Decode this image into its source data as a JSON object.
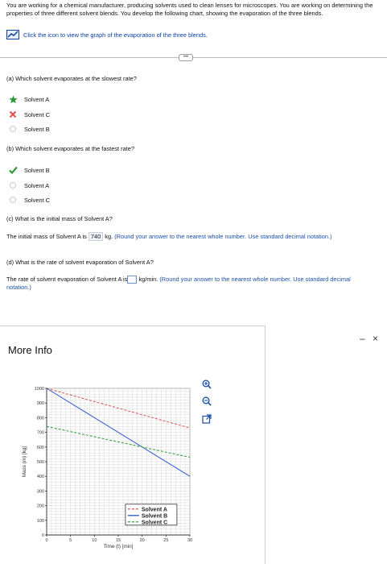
{
  "intro": {
    "text": "You are working for a chemical manufacturer, producing solvents used to clean lenses for microscopes. You are working on determining the properties of three different solvent blends. You develop the following chart, showing the evaporation of the three blends.",
    "graph_link": "Click the icon to view the graph of the evaporation of the three blends."
  },
  "questions": {
    "a": {
      "text": "(a) Which solvent evaporates at the slowest rate?",
      "options": [
        "Solvent A",
        "Solvent C",
        "Solvent B"
      ]
    },
    "b": {
      "text": "(b) Which solvent evaporates at the fastest rate?",
      "options": [
        "Solvent B",
        "Solvent A",
        "Solvent C"
      ]
    },
    "c": {
      "text": "(c) What is the initial mass of Solvent A?",
      "answer_prefix": "The initial mass of Solvent A is",
      "answer_value": "740",
      "answer_unit": "kg.",
      "answer_hint": "(Round your answer to the nearest whole number. Use standard decimal notation.)"
    },
    "d": {
      "text": "(d) What is the rate of solvent evaporation of Solvent A?",
      "answer_prefix": "The rate of solvent evaporation of Solvent A is",
      "answer_unit": "kg/min.",
      "answer_hint": "(Round your answer to the nearest whole number. Use standard decimal notation.)"
    }
  },
  "panel": {
    "title": "More Info",
    "minimize": "–",
    "close": "×"
  },
  "colors": {
    "link": "#0b3fa5",
    "solvent_a": "#d9534f",
    "solvent_b": "#2f55d4",
    "solvent_c": "#2e9b3a",
    "correct": "#2e9b3a",
    "wrong": "#d9534f"
  },
  "chart_data": {
    "type": "line",
    "xlabel": "Time (t) [min]",
    "ylabel": "Mass (m) [kg]",
    "xlim": [
      0,
      30
    ],
    "ylim": [
      0,
      1000
    ],
    "xticks": [
      0,
      5,
      10,
      15,
      20,
      25,
      30
    ],
    "yticks": [
      0,
      100,
      200,
      300,
      400,
      500,
      600,
      700,
      800,
      900,
      1000
    ],
    "grid": true,
    "legend": "bottom-right",
    "series": [
      {
        "name": "Solvent A",
        "style": "dashed",
        "x": [
          0,
          30
        ],
        "y": [
          1000,
          730
        ]
      },
      {
        "name": "Solvent B",
        "style": "solid",
        "x": [
          0,
          30
        ],
        "y": [
          1000,
          400
        ]
      },
      {
        "name": "Solvent C",
        "style": "dashed",
        "x": [
          0,
          30
        ],
        "y": [
          740,
          530
        ]
      }
    ]
  }
}
